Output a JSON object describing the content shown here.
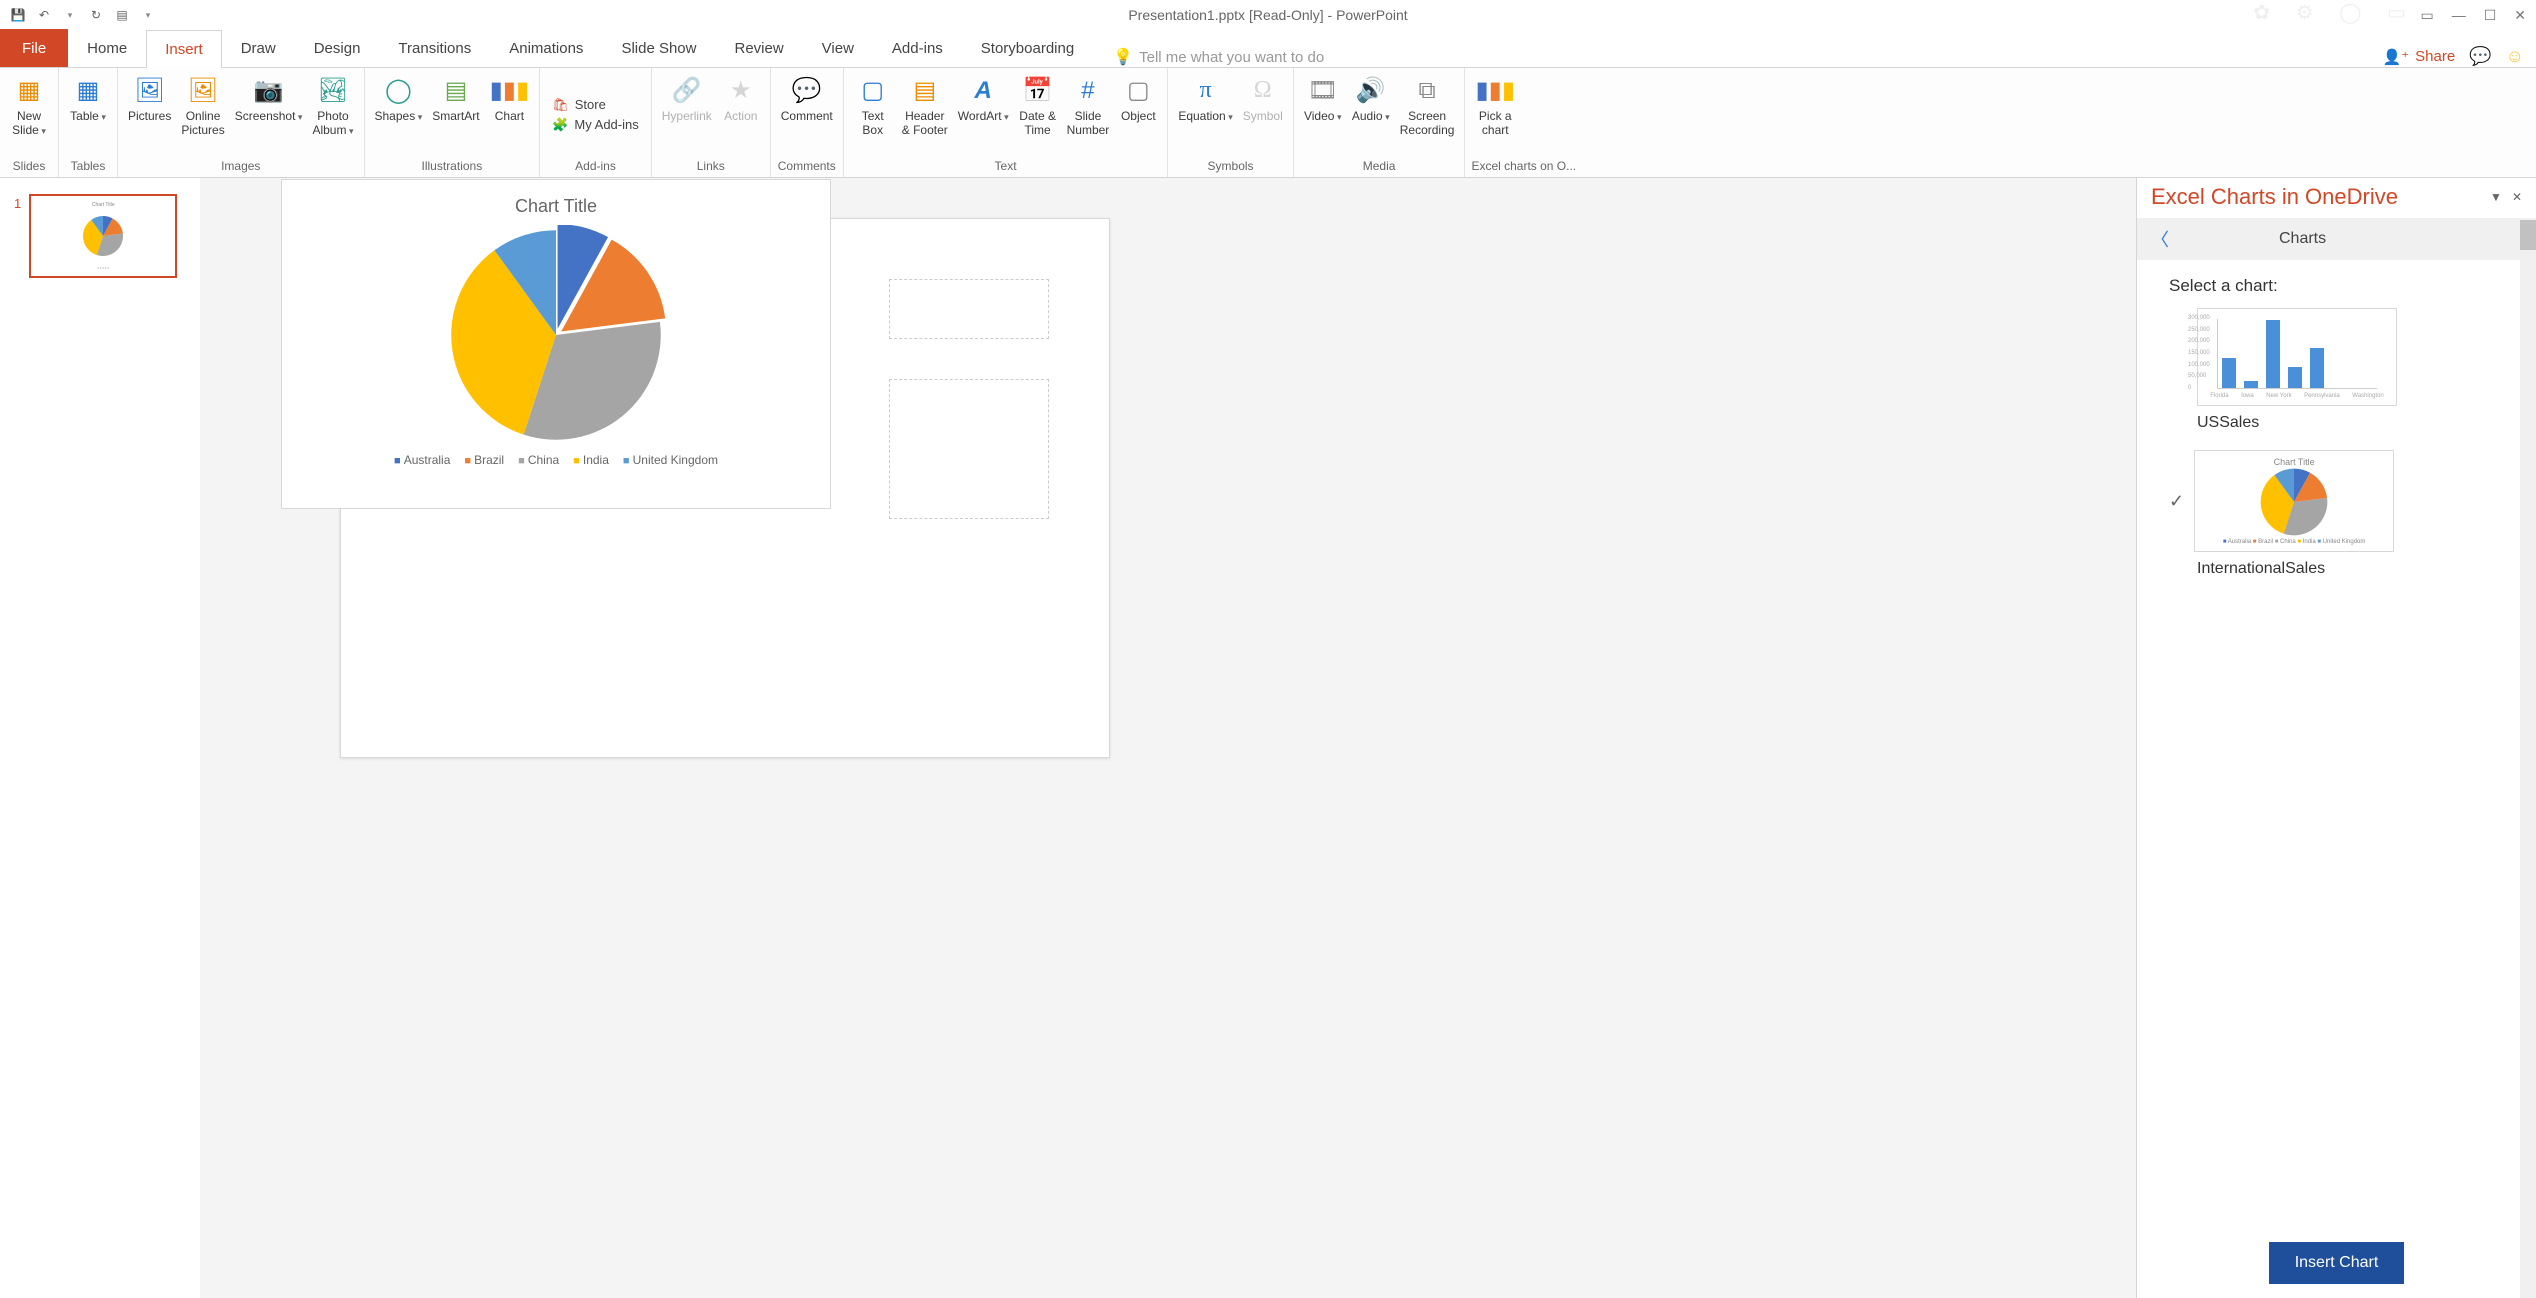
{
  "titlebar": {
    "title": "Presentation1.pptx [Read-Only] - PowerPoint"
  },
  "share": {
    "label": "Share"
  },
  "tabs": {
    "file": "File",
    "home": "Home",
    "insert": "Insert",
    "draw": "Draw",
    "design": "Design",
    "transitions": "Transitions",
    "animations": "Animations",
    "slideshow": "Slide Show",
    "review": "Review",
    "view": "View",
    "addins": "Add-ins",
    "storyboarding": "Storyboarding",
    "tellme": "Tell me what you want to do"
  },
  "ribbon": {
    "new_slide": "New\nSlide",
    "table": "Table",
    "pictures": "Pictures",
    "online_pictures": "Online\nPictures",
    "screenshot": "Screenshot",
    "photo_album": "Photo\nAlbum",
    "shapes": "Shapes",
    "smartart": "SmartArt",
    "chart": "Chart",
    "store": "Store",
    "my_addins": "My Add-ins",
    "hyperlink": "Hyperlink",
    "action": "Action",
    "comment": "Comment",
    "text_box": "Text\nBox",
    "header_footer": "Header\n& Footer",
    "wordart": "WordArt",
    "date_time": "Date &\nTime",
    "slide_number": "Slide\nNumber",
    "object": "Object",
    "equation": "Equation",
    "symbol": "Symbol",
    "video": "Video",
    "audio": "Audio",
    "screen_recording": "Screen\nRecording",
    "pick_chart": "Pick a\nchart",
    "groups": {
      "slides": "Slides",
      "tables": "Tables",
      "images": "Images",
      "illustrations": "Illustrations",
      "addins": "Add-ins",
      "links": "Links",
      "comments": "Comments",
      "text": "Text",
      "symbols": "Symbols",
      "media": "Media",
      "excel_charts": "Excel charts on O..."
    }
  },
  "thumb": {
    "num": "1"
  },
  "taskpane": {
    "title": "Excel Charts in OneDrive",
    "nav": "Charts",
    "select": "Select a chart:",
    "us": "USSales",
    "intl": "InternationalSales",
    "insert": "Insert Chart",
    "card2_title": "Chart Title",
    "card2_legend": "Australia  Brazil  China  India  United Kingdom"
  },
  "chart_data": {
    "type": "pie",
    "title": "Chart Title",
    "categories": [
      "Australia",
      "Brazil",
      "China",
      "India",
      "United Kingdom"
    ],
    "values": [
      8,
      15,
      32,
      35,
      10
    ],
    "colors": [
      "#4472c4",
      "#ed7d31",
      "#a5a5a5",
      "#ffc000",
      "#5b9bd5"
    ]
  },
  "chart_data_bar": {
    "type": "bar",
    "categories": [
      "Florida",
      "Iowa",
      "New York",
      "Pennsylvania",
      "Washington"
    ],
    "values": [
      130000,
      30000,
      290000,
      90000,
      170000
    ],
    "ylim": [
      0,
      300000
    ],
    "yticks": [
      0,
      50000,
      100000,
      150000,
      200000,
      250000,
      300000
    ]
  }
}
